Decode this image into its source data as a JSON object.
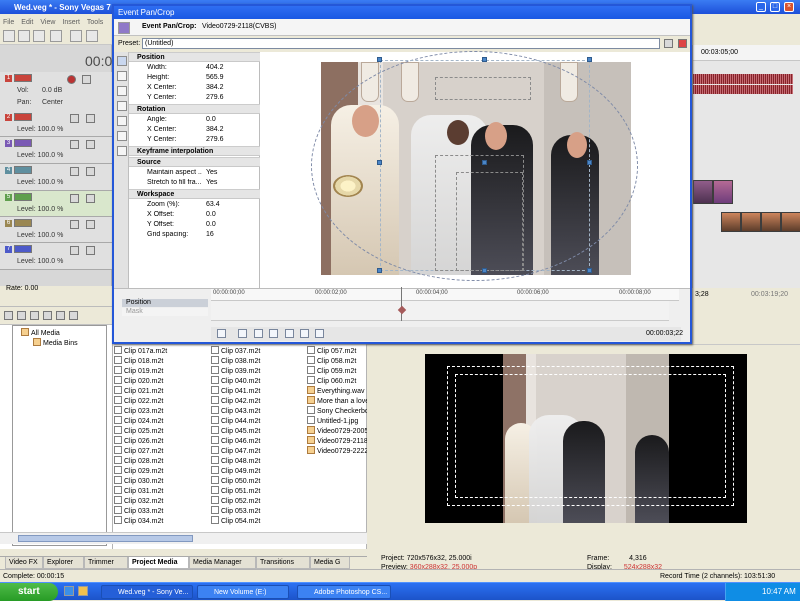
{
  "app": {
    "title": "Wed.veg * - Sony Vegas 7"
  },
  "menu": [
    "File",
    "Edit",
    "View",
    "Insert",
    "Tools"
  ],
  "time": {
    "main": "00:0",
    "timeline_end": "00:03:19;20",
    "cursor": "3;28"
  },
  "tracks": [
    {
      "number": "1",
      "vol": "Vol:",
      "vol_value": "0.0 dB",
      "pan": "Pan:",
      "pan_value": "Center",
      "color": "#c9443c"
    },
    {
      "number": "2",
      "level": "Level: 100.0 %",
      "color": "#c9443c"
    },
    {
      "number": "3",
      "level": "Level: 100.0 %",
      "color": "#7a59b4"
    },
    {
      "number": "4",
      "level": "Level: 100.0 %",
      "color": "#5f8f9f"
    },
    {
      "number": "5",
      "level": "Level: 100.0 %",
      "color": "#5f9f4d"
    },
    {
      "number": "6",
      "level": "Level: 100.0 %",
      "color": "#9a8752"
    },
    {
      "number": "7",
      "level": "Level: 100.0 %",
      "color": "#4d5ac9"
    }
  ],
  "rate": "Rate: 0.00",
  "timeline": {
    "ruler": "00:03:05;00"
  },
  "dialog": {
    "title": "Event Pan/Crop",
    "header": "Event Pan/Crop:",
    "clip": "Video0729-2118(CVBS)",
    "preset_label": "Preset:",
    "preset_value": "(Untitled)",
    "sections": {
      "position": "Position",
      "rotation": "Rotation",
      "keyframe": "Keyframe interpolation",
      "source": "Source",
      "workspace": "Workspace"
    },
    "properties": {
      "width_label": "Width:",
      "width": "404.2",
      "height_label": "Height:",
      "height": "565.9",
      "xcenter_label": "X Center:",
      "xcenter": "384.2",
      "ycenter_label": "Y Center:",
      "ycenter": "279.6",
      "angle_label": "Angle:",
      "angle": "0.0",
      "rx_label": "X Center:",
      "rx": "384.2",
      "ry_label": "Y Center:",
      "ry": "279.6",
      "maintain_label": "Maintain aspect ...",
      "maintain": "Yes",
      "stretch_label": "Stretch to fill fra...",
      "stretch": "Yes",
      "zoom_label": "Zoom (%):",
      "zoom": "63.4",
      "xoffset_label": "X Offset:",
      "xoffset": "0.0",
      "yoffset_label": "Y Offset:",
      "yoffset": "0.0",
      "grid_label": "Grid spacing:",
      "grid": "16"
    },
    "keyframes": {
      "label": "Position",
      "mask": "Mask",
      "times": [
        "00:00:00;00",
        "00:00:02;00",
        "00:00:04;00",
        "00:00:06;00",
        "00:00:08;00"
      ],
      "current": "00:00:03;22"
    }
  },
  "media": {
    "tree": [
      "All Media",
      "Media Bins"
    ],
    "files": [
      "Clip 017a.m2t",
      "Clip 018.m2t",
      "Clip 019.m2t",
      "Clip 020.m2t",
      "Clip 021.m2t",
      "Clip 022.m2t",
      "Clip 023.m2t",
      "Clip 024.m2t",
      "Clip 025.m2t",
      "Clip 026.m2t",
      "Clip 027.m2t",
      "Clip 028.m2t",
      "Clip 029.m2t",
      "Clip 030.m2t",
      "Clip 031.m2t",
      "Clip 032.m2t",
      "Clip 033.m2t",
      "Clip 034.m2t",
      "Clip 037.m2t",
      "Clip 038.m2t",
      "Clip 039.m2t",
      "Clip 040.m2t",
      "Clip 041.m2t",
      "Clip 042.m2t",
      "Clip 043.m2t",
      "Clip 044.m2t",
      "Clip 045.m2t",
      "Clip 046.m2t",
      "Clip 047.m2t",
      "Clip 048.m2t",
      "Clip 049.m2t",
      "Clip 050.m2t",
      "Clip 051.m2t",
      "Clip 052.m2t",
      "Clip 053.m2t",
      "Clip 054.m2t",
      "Clip 057.m2t",
      "Clip 058.m2t",
      "Clip 059.m2t",
      "Clip 060.m2t",
      "Everything.wav",
      "More than a love",
      "Sony Checkerbo",
      "Untitled-1.jpg",
      "Video0729-2005",
      "Video0729-2118",
      "Video0729-2222"
    ]
  },
  "tabs": [
    "Video FX",
    "Explorer",
    "Trimmer",
    "Project Media",
    "Media Manager",
    "Transitions",
    "Media G"
  ],
  "preview": {
    "project_label": "Project:",
    "project": "720x576x32, 25.000i",
    "preview_label": "Preview:",
    "preview": "360x288x32, 25.000p",
    "frame_label": "Frame:",
    "frame": "4,316",
    "display_label": "Display:",
    "display": "524x288x32"
  },
  "status": {
    "complete": "Complete: 00:00:15",
    "record": "Record Time (2 channels): 103:51:30"
  },
  "taskbar": {
    "start": "start",
    "items": [
      "Wed.veg * - Sony Ve...",
      "New Volume (E:)",
      "Adobe Photoshop CS..."
    ],
    "time": "10:47 AM"
  },
  "colors": {
    "xp_blue": "#1d4fd9",
    "start_green": "#279b25"
  }
}
